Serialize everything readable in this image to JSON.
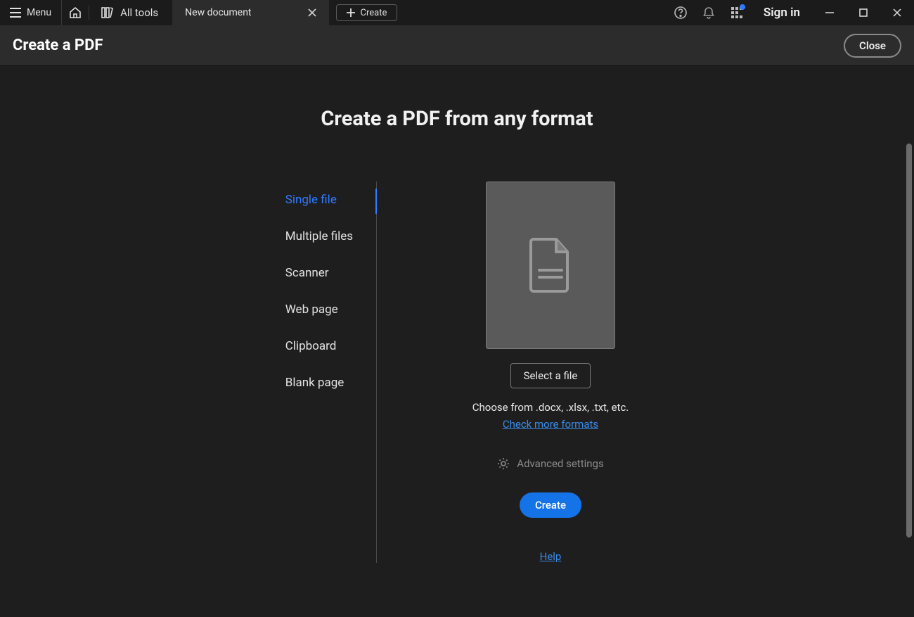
{
  "titlebar": {
    "menu_label": "Menu",
    "all_tools_label": "All tools",
    "tab_label": "New document",
    "create_button_label": "Create",
    "sign_in_label": "Sign in"
  },
  "subheader": {
    "title": "Create a PDF",
    "close_label": "Close"
  },
  "main": {
    "heading": "Create a PDF from any format",
    "options": [
      "Single file",
      "Multiple files",
      "Scanner",
      "Web page",
      "Clipboard",
      "Blank page"
    ],
    "active_option_index": 0,
    "select_file_label": "Select a file",
    "hint_text": "Choose from .docx, .xlsx, .txt, etc.",
    "more_formats_link": "Check more formats",
    "advanced_label": "Advanced settings",
    "create_label": "Create",
    "help_label": "Help"
  }
}
